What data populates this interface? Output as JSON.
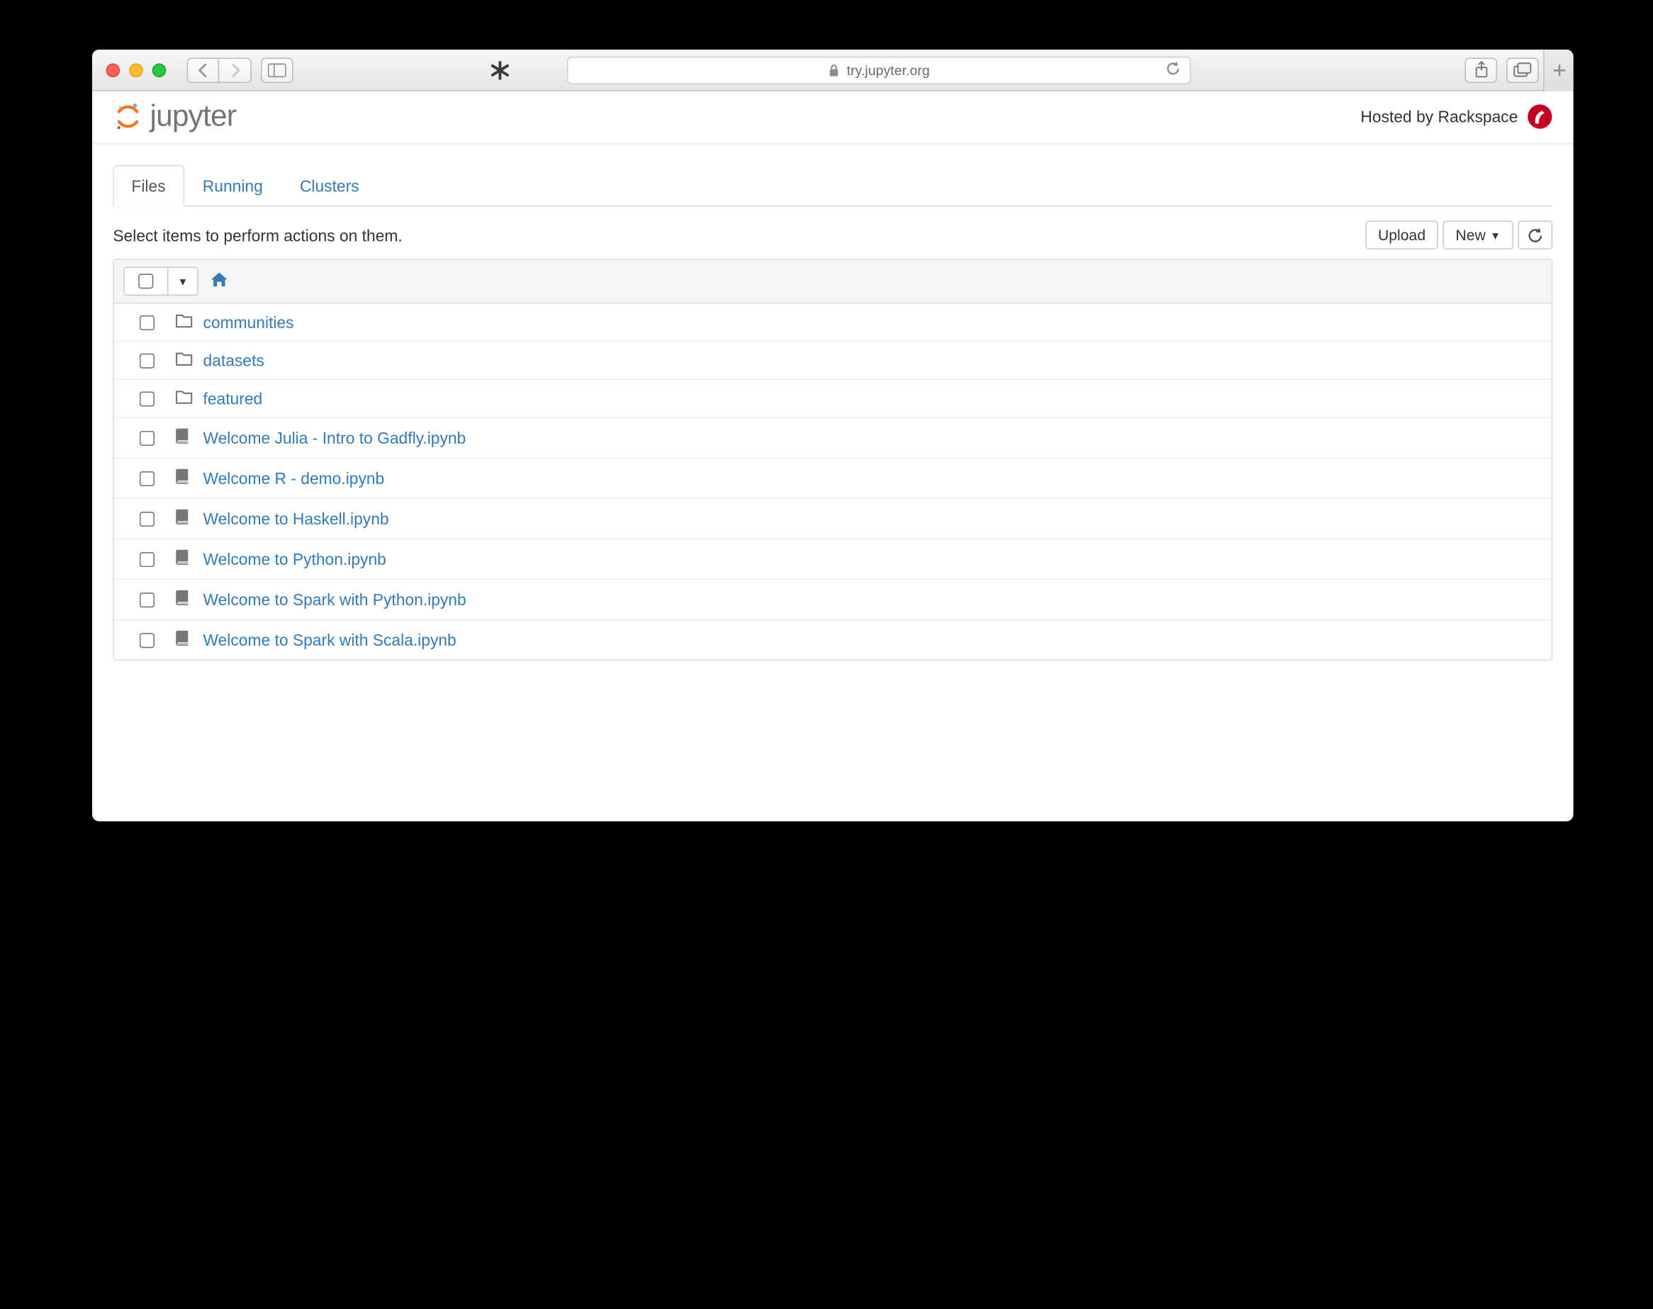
{
  "browser": {
    "url_host": "try.jupyter.org"
  },
  "header": {
    "logo_text": "jupyter",
    "hosted_by": "Hosted by Rackspace"
  },
  "tabs": [
    {
      "label": "Files",
      "active": true
    },
    {
      "label": "Running",
      "active": false
    },
    {
      "label": "Clusters",
      "active": false
    }
  ],
  "toolbar": {
    "hint": "Select items to perform actions on them.",
    "upload": "Upload",
    "new": "New"
  },
  "files": [
    {
      "type": "folder",
      "name": "communities"
    },
    {
      "type": "folder",
      "name": "datasets"
    },
    {
      "type": "folder",
      "name": "featured"
    },
    {
      "type": "notebook",
      "name": "Welcome Julia - Intro to Gadfly.ipynb"
    },
    {
      "type": "notebook",
      "name": "Welcome R - demo.ipynb"
    },
    {
      "type": "notebook",
      "name": "Welcome to Haskell.ipynb"
    },
    {
      "type": "notebook",
      "name": "Welcome to Python.ipynb"
    },
    {
      "type": "notebook",
      "name": "Welcome to Spark with Python.ipynb"
    },
    {
      "type": "notebook",
      "name": "Welcome to Spark with Scala.ipynb"
    }
  ]
}
